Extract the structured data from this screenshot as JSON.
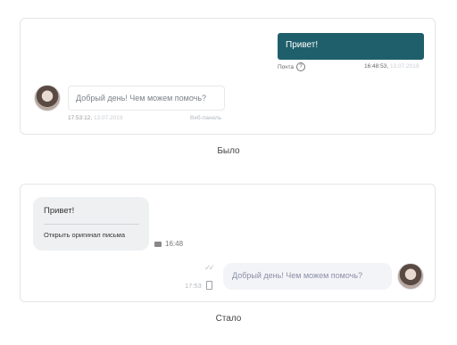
{
  "before": {
    "caption": "Было",
    "outgoing": {
      "text": "Привет!",
      "sender": "Почта",
      "sender_help_icon": "question-circle-icon",
      "time": "16:48:53",
      "date": "13.07.2019"
    },
    "incoming": {
      "text": "Добрый день! Чем можем помочь?",
      "time": "17:53:12",
      "date": "13.07.2019",
      "channel": "Веб-панель"
    }
  },
  "after": {
    "caption": "Стало",
    "incoming": {
      "text": "Привет!",
      "link": "Открыть оригинал письма",
      "channel_icon": "mail-icon",
      "time": "16:48"
    },
    "outgoing": {
      "text": "Добрый день! Чем можем помочь?",
      "read_icon": "double-check-icon",
      "time": "17:53",
      "device_icon": "phone-icon"
    }
  },
  "colors": {
    "teal_bubble": "#1f5f6b",
    "grey_bubble": "#eef0f2",
    "light_bubble": "#f3f4f7",
    "border": "#e3e5e8"
  }
}
